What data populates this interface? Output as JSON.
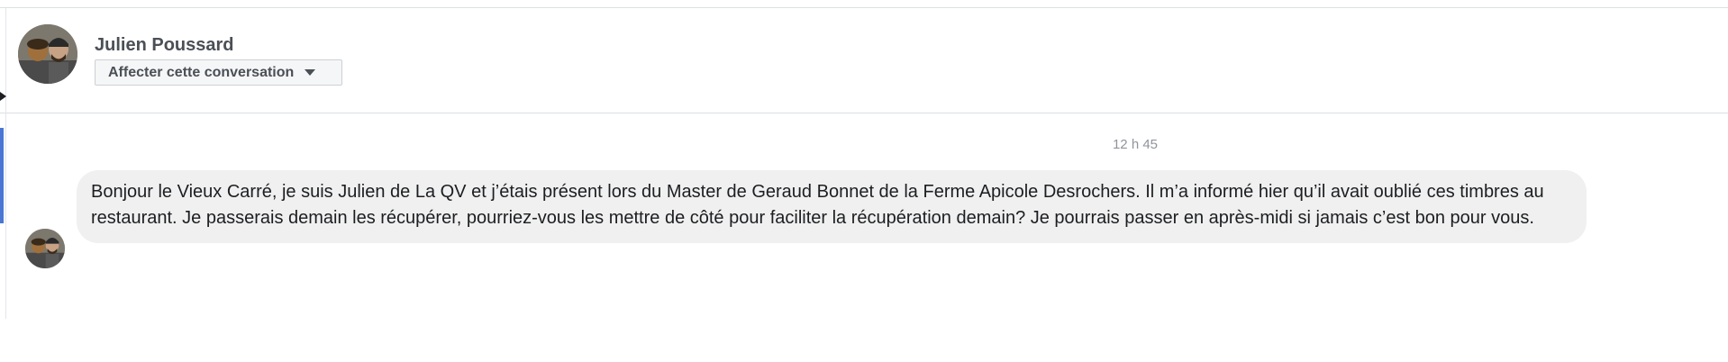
{
  "conversation": {
    "contact_name": "Julien Poussard",
    "assign_button_label": "Affecter cette conversation"
  },
  "messages": [
    {
      "timestamp": "12 h 45",
      "text": "Bonjour le Vieux Carré, je suis Julien de La QV et j’étais présent lors du Master de Geraud Bonnet de la Ferme Apicole Desrochers. Il m’a informé hier qu’il avait oublié ces timbres au restaurant. Je passerais demain les récupérer, pourriez-vous les mettre de côté pour faciliter la récupération demain? Je pourrais passer en après-midi si jamais c’est bon pour vous."
    }
  ],
  "colors": {
    "bubble_background": "#f0f0f0",
    "accent": "#4a76d4",
    "name_text": "#4b4f56",
    "timestamp_text": "#90949c"
  },
  "icons": {
    "assign_caret": "caret-down-icon"
  }
}
